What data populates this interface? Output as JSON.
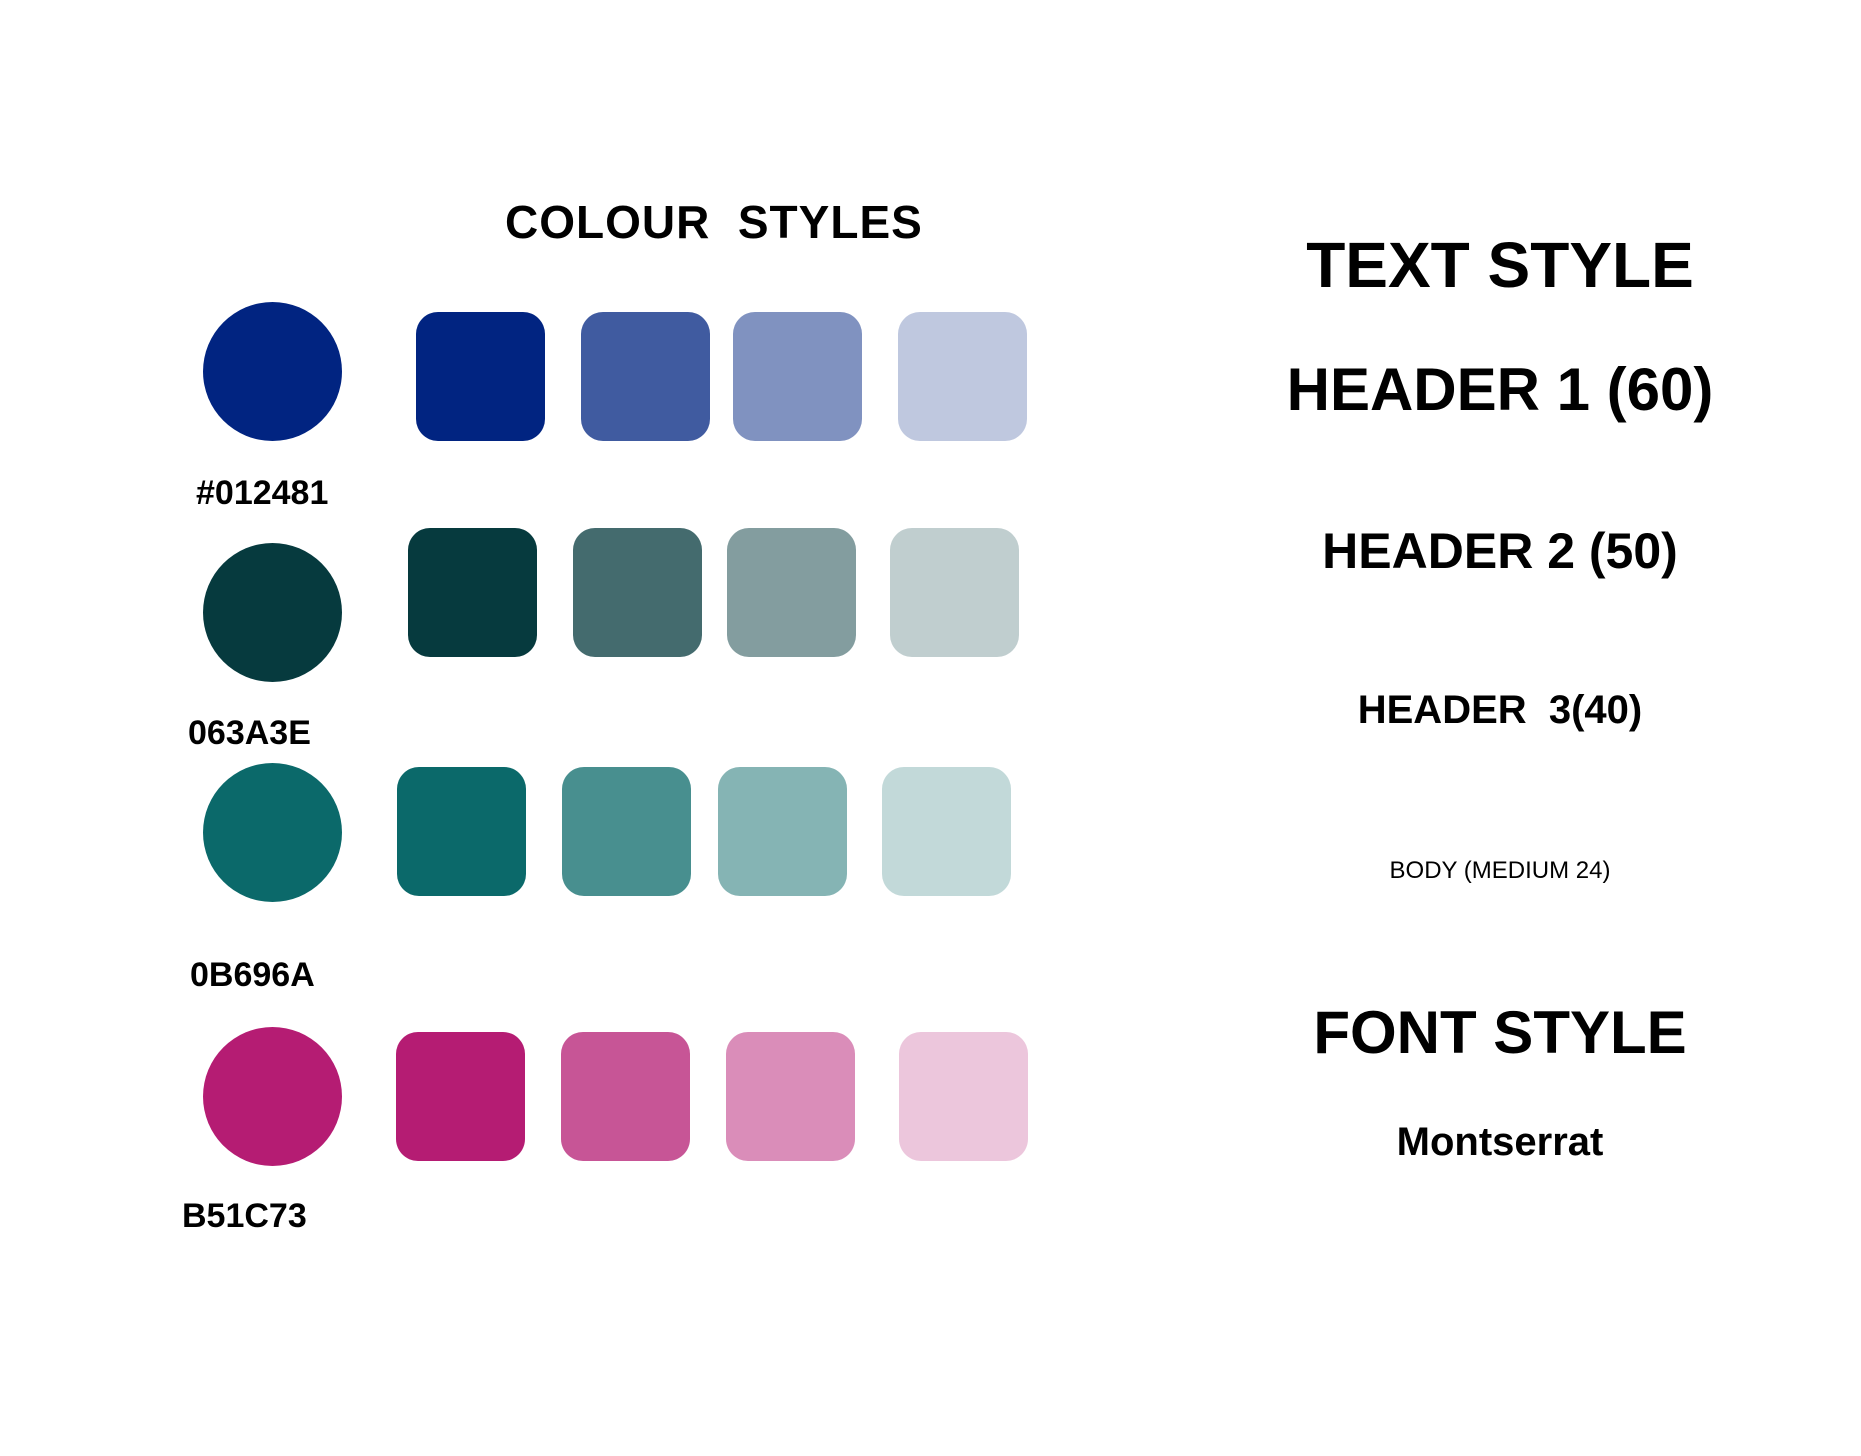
{
  "colour_section": {
    "title": "COLOUR  STYLES",
    "palettes": [
      {
        "label": "#012481",
        "base": "#012481",
        "tints": [
          "#012481",
          "#405BA0",
          "#8092C0",
          "#BFC8DF"
        ]
      },
      {
        "label": "063A3E",
        "base": "#063A3E",
        "tints": [
          "#063A3E",
          "#446B6E",
          "#839D9F",
          "#C0CECF"
        ]
      },
      {
        "label": "0B696A",
        "base": "#0B696A",
        "tints": [
          "#0B696A",
          "#488F8F",
          "#85B4B4",
          "#C2D9D9"
        ]
      },
      {
        "label": "B51C73",
        "base": "#B51C73",
        "tints": [
          "#B51C73",
          "#C75596",
          "#DA8DB9",
          "#ECC6DC"
        ]
      }
    ]
  },
  "text_section": {
    "title": "TEXT STYLE",
    "header1": "HEADER 1 (60)",
    "header2": "HEADER 2 (50)",
    "header3": "HEADER  3(40)",
    "body": "BODY (MEDIUM 24)"
  },
  "font_section": {
    "title": "FONT STYLE",
    "font_name": "Montserrat"
  }
}
